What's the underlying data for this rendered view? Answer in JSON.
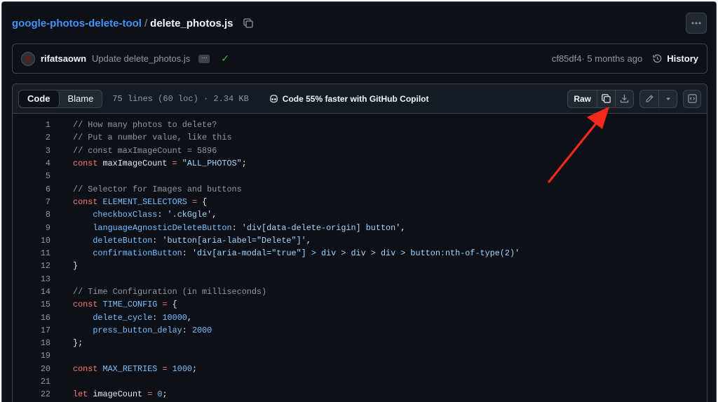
{
  "breadcrumb": {
    "repo": "google-photos-delete-tool",
    "separator": "/",
    "file": "delete_photos.js"
  },
  "commit": {
    "author": "rifatsaown",
    "message": "Update delete_photos.js",
    "ellipsis": "···",
    "status": "✓",
    "sha": "cf85df4",
    "age": " · 5 months ago",
    "history_label": "History"
  },
  "file_header": {
    "tab_code": "Code",
    "tab_blame": "Blame",
    "meta": "75 lines (60 loc) · 2.34 KB",
    "copilot": "Code 55% faster with GitHub Copilot",
    "raw_label": "Raw"
  },
  "code_lines": [
    {
      "n": "1",
      "tokens": [
        {
          "t": "// How many photos to delete?",
          "k": "com"
        }
      ]
    },
    {
      "n": "2",
      "tokens": [
        {
          "t": "// Put a number value, like this",
          "k": "com"
        }
      ]
    },
    {
      "n": "3",
      "tokens": [
        {
          "t": "// const maxImageCount = 5896",
          "k": "com"
        }
      ]
    },
    {
      "n": "4",
      "tokens": [
        {
          "t": "const",
          "k": "kw"
        },
        {
          "t": " maxImageCount ",
          "k": "plain"
        },
        {
          "t": "=",
          "k": "kw"
        },
        {
          "t": " ",
          "k": "plain"
        },
        {
          "t": "\"ALL_PHOTOS\"",
          "k": "str"
        },
        {
          "t": ";",
          "k": "plain"
        }
      ]
    },
    {
      "n": "5",
      "tokens": []
    },
    {
      "n": "6",
      "tokens": [
        {
          "t": "// Selector for Images and buttons",
          "k": "com"
        }
      ]
    },
    {
      "n": "7",
      "tokens": [
        {
          "t": "const",
          "k": "kw"
        },
        {
          "t": " ",
          "k": "plain"
        },
        {
          "t": "ELEMENT_SELECTORS",
          "k": "var"
        },
        {
          "t": " ",
          "k": "plain"
        },
        {
          "t": "=",
          "k": "kw"
        },
        {
          "t": " {",
          "k": "plain"
        }
      ]
    },
    {
      "n": "8",
      "tokens": [
        {
          "t": "    ",
          "k": "plain"
        },
        {
          "t": "checkboxClass",
          "k": "prop"
        },
        {
          "t": ": ",
          "k": "plain"
        },
        {
          "t": "'.ckGgle'",
          "k": "str"
        },
        {
          "t": ",",
          "k": "plain"
        }
      ]
    },
    {
      "n": "9",
      "tokens": [
        {
          "t": "    ",
          "k": "plain"
        },
        {
          "t": "languageAgnosticDeleteButton",
          "k": "prop"
        },
        {
          "t": ": ",
          "k": "plain"
        },
        {
          "t": "'div[data-delete-origin] button'",
          "k": "str"
        },
        {
          "t": ",",
          "k": "plain"
        }
      ]
    },
    {
      "n": "10",
      "tokens": [
        {
          "t": "    ",
          "k": "plain"
        },
        {
          "t": "deleteButton",
          "k": "prop"
        },
        {
          "t": ": ",
          "k": "plain"
        },
        {
          "t": "'button[aria-label=\"Delete\"]'",
          "k": "str"
        },
        {
          "t": ",",
          "k": "plain"
        }
      ]
    },
    {
      "n": "11",
      "tokens": [
        {
          "t": "    ",
          "k": "plain"
        },
        {
          "t": "confirmationButton",
          "k": "prop"
        },
        {
          "t": ": ",
          "k": "plain"
        },
        {
          "t": "'div[aria-modal=\"true\"] > div > div > div > button:nth-of-type(2)'",
          "k": "str"
        }
      ]
    },
    {
      "n": "12",
      "tokens": [
        {
          "t": "}",
          "k": "plain"
        }
      ]
    },
    {
      "n": "13",
      "tokens": []
    },
    {
      "n": "14",
      "tokens": [
        {
          "t": "// Time Configuration (in milliseconds)",
          "k": "com"
        }
      ]
    },
    {
      "n": "15",
      "tokens": [
        {
          "t": "const",
          "k": "kw"
        },
        {
          "t": " ",
          "k": "plain"
        },
        {
          "t": "TIME_CONFIG",
          "k": "var"
        },
        {
          "t": " ",
          "k": "plain"
        },
        {
          "t": "=",
          "k": "kw"
        },
        {
          "t": " {",
          "k": "plain"
        }
      ]
    },
    {
      "n": "16",
      "tokens": [
        {
          "t": "    ",
          "k": "plain"
        },
        {
          "t": "delete_cycle",
          "k": "prop"
        },
        {
          "t": ": ",
          "k": "plain"
        },
        {
          "t": "10000",
          "k": "var"
        },
        {
          "t": ",",
          "k": "plain"
        }
      ]
    },
    {
      "n": "17",
      "tokens": [
        {
          "t": "    ",
          "k": "plain"
        },
        {
          "t": "press_button_delay",
          "k": "prop"
        },
        {
          "t": ": ",
          "k": "plain"
        },
        {
          "t": "2000",
          "k": "var"
        }
      ]
    },
    {
      "n": "18",
      "tokens": [
        {
          "t": "};",
          "k": "plain"
        }
      ]
    },
    {
      "n": "19",
      "tokens": []
    },
    {
      "n": "20",
      "tokens": [
        {
          "t": "const",
          "k": "kw"
        },
        {
          "t": " ",
          "k": "plain"
        },
        {
          "t": "MAX_RETRIES",
          "k": "var"
        },
        {
          "t": " ",
          "k": "plain"
        },
        {
          "t": "=",
          "k": "kw"
        },
        {
          "t": " ",
          "k": "plain"
        },
        {
          "t": "1000",
          "k": "var"
        },
        {
          "t": ";",
          "k": "plain"
        }
      ]
    },
    {
      "n": "21",
      "tokens": []
    },
    {
      "n": "22",
      "tokens": [
        {
          "t": "let",
          "k": "kw"
        },
        {
          "t": " imageCount ",
          "k": "plain"
        },
        {
          "t": "=",
          "k": "kw"
        },
        {
          "t": " ",
          "k": "plain"
        },
        {
          "t": "0",
          "k": "var"
        },
        {
          "t": ";",
          "k": "plain"
        }
      ]
    }
  ],
  "icons": {
    "copy_path": "copy-icon",
    "more": "kebab-horizontal-icon",
    "history": "history-icon",
    "copilot": "copilot-icon",
    "copy_raw": "copy-icon",
    "download": "download-icon",
    "edit": "pencil-icon",
    "dropdown": "triangle-down-icon",
    "symbols": "code-square-icon"
  },
  "colors": {
    "annotation_arrow": "#f42a1c",
    "link": "#4493f8",
    "success": "#3fb950"
  }
}
